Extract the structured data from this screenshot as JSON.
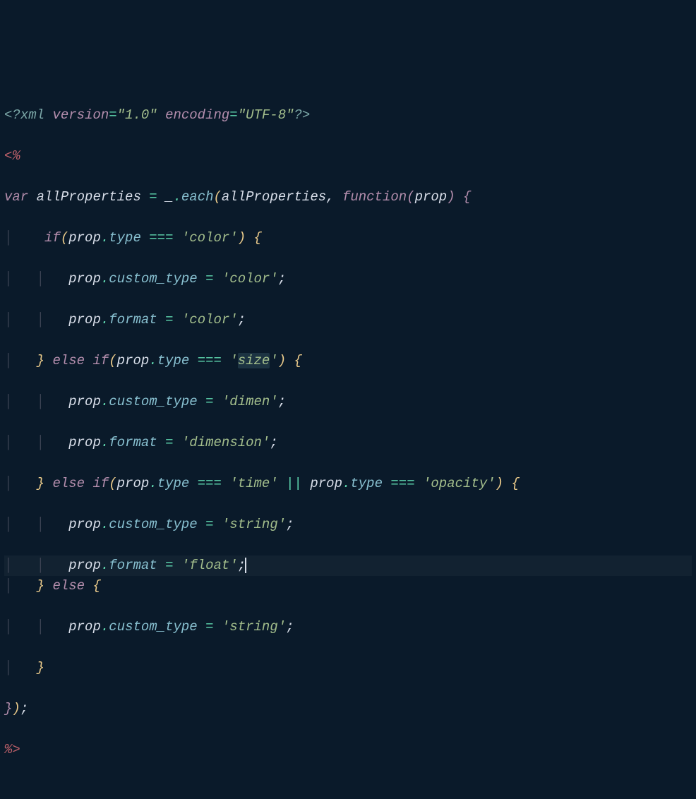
{
  "code": {
    "l1_open": "<?",
    "l1_xml": "xml ",
    "l1_ver_name": "version",
    "l1_eq": "=",
    "l1_ver_val": "\"1.0\"",
    "l1_sp": " ",
    "l1_enc_name": "encoding",
    "l1_enc_val": "\"UTF-8\"",
    "l1_close": "?>",
    "l2": "<%",
    "l3_var": "var",
    "l3_sp1": " ",
    "l3_id": "allProperties ",
    "l3_eq": "= ",
    "l3_under": "_",
    "l3_dot": ".",
    "l3_each": "each",
    "l3_lp": "(",
    "l3_arg1": "allProperties",
    "l3_comma": ", ",
    "l3_func": "function",
    "l3_lp2": "(",
    "l3_prop": "prop",
    "l3_rp2": ")",
    "l3_sp2": " ",
    "l3_lb": "{",
    "l4_if": "if",
    "l4_lp": "(",
    "l4_prop": "prop",
    "l4_dot": ".",
    "l4_type": "type ",
    "l4_eqeq": "=== ",
    "l4_str": "'color'",
    "l4_rp": ")",
    "l4_sp": " ",
    "l4_lb": "{",
    "l5_prop": "prop",
    "l5_dot": ".",
    "l5_ct": "custom_type ",
    "l5_eq": "= ",
    "l5_str": "'color'",
    "l5_sc": ";",
    "l6_prop": "prop",
    "l6_dot": ".",
    "l6_fmt": "format ",
    "l6_eq": "= ",
    "l6_str": "'color'",
    "l6_sc": ";",
    "l7_rb": "}",
    "l7_sp": " ",
    "l7_else": "else",
    "l7_sp2": " ",
    "l7_if": "if",
    "l7_lp": "(",
    "l7_prop": "prop",
    "l7_dot": ".",
    "l7_type": "type ",
    "l7_eqeq": "=== ",
    "l7_str": "'size'",
    "l7_rp": ")",
    "l7_sp3": " ",
    "l7_lb": "{",
    "l8_prop": "prop",
    "l8_dot": ".",
    "l8_ct": "custom_type ",
    "l8_eq": "= ",
    "l8_str": "'dimen'",
    "l8_sc": ";",
    "l9_prop": "prop",
    "l9_dot": ".",
    "l9_fmt": "format ",
    "l9_eq": "= ",
    "l9_str": "'dimension'",
    "l9_sc": ";",
    "l10_rb": "}",
    "l10_sp": " ",
    "l10_else": "else",
    "l10_sp2": " ",
    "l10_if": "if",
    "l10_lp": "(",
    "l10_prop": "prop",
    "l10_dot": ".",
    "l10_type": "type ",
    "l10_eqeq": "=== ",
    "l10_str": "'time'",
    "l10_sp3": " ",
    "l10_or": "|| ",
    "l10_prop2": "prop",
    "l10_dot2": ".",
    "l10_type2": "type ",
    "l10_eqeq2": "=== ",
    "l10_str2": "'opacity'",
    "l10_rp": ")",
    "l10_sp4": " ",
    "l10_lb": "{",
    "l11_prop": "prop",
    "l11_dot": ".",
    "l11_ct": "custom_type ",
    "l11_eq": "= ",
    "l11_str": "'string'",
    "l11_sc": ";",
    "l12_prop": "prop",
    "l12_dot": ".",
    "l12_fmt": "format ",
    "l12_eq": "= ",
    "l12_str": "'float'",
    "l12_sc": ";",
    "l13_rb": "}",
    "l13_sp": " ",
    "l13_else": "else",
    "l13_sp2": " ",
    "l13_lb": "{",
    "l14_prop": "prop",
    "l14_dot": ".",
    "l14_ct": "custom_type ",
    "l14_eq": "= ",
    "l14_str": "'string'",
    "l14_sc": ";",
    "l15_rb": "}",
    "l16_rb": "}",
    "l16_rp": ")",
    "l16_sc": ";",
    "l17": "%>",
    "ig": "│",
    "ig2": "│   ",
    "sp4": "    ",
    "sp8": "        "
  }
}
